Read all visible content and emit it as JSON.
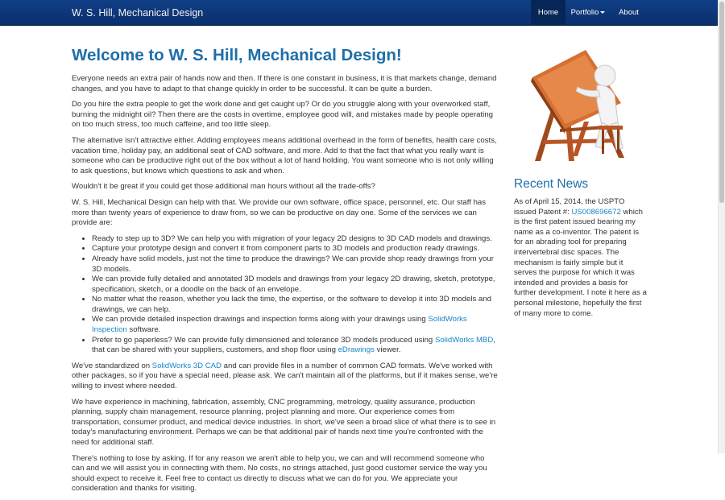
{
  "navbar": {
    "brand": "W. S. Hill, Mechanical Design",
    "items": [
      {
        "label": "Home",
        "active": true
      },
      {
        "label": "Portfolio",
        "dropdown": true
      },
      {
        "label": "About"
      }
    ]
  },
  "main": {
    "title": "Welcome to W. S. Hill, Mechanical Design!",
    "p1": "Everyone needs an extra pair of hands now and then. If there is one constant in business, it is that markets change, demand changes, and you have to adapt to that change quickly in order to be successful. It can be quite a burden.",
    "p2": "Do you hire the extra people to get the work done and get caught up? Or do you struggle along with your overworked staff, burning the midnight oil? Then there are the costs in overtime, employee good will, and mistakes made by people operating on too much stress, too much caffeine, and too little sleep.",
    "p3": "The alternative isn't attractive either. Adding employees means additional overhead in the form of benefits, health care costs, vacation time, holiday pay, an additional seat of CAD software, and more. Add to that the fact that what you really want is someone who can be productive right out of the box without a lot of hand holding. You want someone who is not only willing to ask questions, but knows which questions to ask and when.",
    "p4": "Wouldn't it be great if you could get those additional man hours without all the trade-offs?",
    "p5": "W. S. Hill, Mechanical Design can help with that.  We provide our own software, office space, personnel, etc. Our staff has more than twenty years of experience to draw from, so we can be productive on day one. Some of the services we can provide are:",
    "list": {
      "i1": "Ready to step up to 3D? We can help you with migration of your legacy 2D designs to 3D CAD models and drawings.",
      "i2": "Capture your prototype design and convert it from component parts to 3D models and production ready drawings.",
      "i3": "Already have solid models, just not the time to produce the drawings? We can provide shop ready drawings from your 3D models.",
      "i4": "We can provide fully detailed and annotated 3D models and drawings from your legacy 2D drawing, sketch, prototype, specification, sketch, or a doodle on the back of an envelope.",
      "i5": "No matter what the reason, whether you lack the time, the expertise, or the software to develop it into 3D models and drawings, we can help.",
      "i6_pre": "We can provide detailed inspection drawings and inspection forms along with your drawings using ",
      "i6_link": "SolidWorks Inspection",
      "i6_post": " software.",
      "i7_pre": "Prefer to go paperless? We can provide fully dimensioned and tolerance 3D models produced using ",
      "i7_link1": "SolidWorks MBD",
      "i7_mid": ", that can be shared with your suppliers, customers, and shop floor using ",
      "i7_link2": "eDrawings",
      "i7_post": " viewer."
    },
    "p6_pre": "We've standardized on ",
    "p6_link": "SolidWorks 3D CAD",
    "p6_post": " and can provide files in a number of common CAD formats. We've worked with other packages, so if you have a special need, please ask. We can't maintain all of the platforms, but if it makes sense, we're willing to invest where needed.",
    "p7": "We have experience in machining, fabrication, assembly, CNC programming, metrology, quality assurance, production planning, supply chain management, resource planning, project planning and more. Our experience comes from transportation, consumer product, and medical device industries. In short, we've seen a broad slice of what there is to see in today's manufacturing environment. Perhaps we can be that additional pair of hands next time you're confronted with the need for additional staff.",
    "p8": "There's nothing to lose by asking. If for any reason we aren't able to help you, we can and will recommend someone who can and we will assist you in  connecting with them. No costs, no strings attached, just good customer service the way you should expect to receive it. Feel free to contact us directly to discuss what we can do for you. We appreciate your consideration and thanks for visiting."
  },
  "sidebar": {
    "illustration_icon": "drafting-table-figure-icon",
    "news_title": "Recent News",
    "news_pre": "As of April 15, 2014, the USPTO issued Patent #: ",
    "news_link": "US008696672",
    "news_post": " which is the first patent issued bearing my name as a co-inventor. The patent is for an abrading tool for preparing intervertebral disc spaces. The mechanism is fairly simple but it serves the purpose for which it was intended and provides a basis for further development. I note it here as a personal milestone, hopefully the first of many more to come."
  },
  "colors": {
    "navbar": "#0d3a7d",
    "nav_active": "#062657",
    "heading": "#1d6fa8",
    "link": "#1a86c8",
    "drafting_table": "#c8632a"
  }
}
